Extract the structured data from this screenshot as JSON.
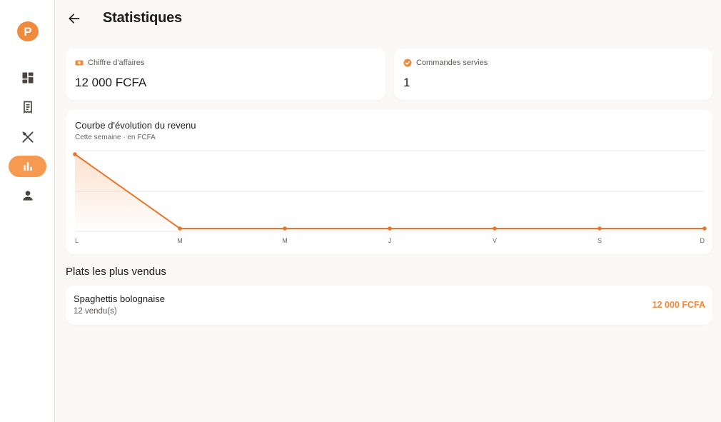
{
  "app": {
    "logo_letter": "P",
    "brand_color": "#f08a3c"
  },
  "sidebar": {
    "items": [
      {
        "icon": "dashboard-icon",
        "active": false
      },
      {
        "icon": "receipt-icon",
        "active": false
      },
      {
        "icon": "restaurant-icon",
        "active": false
      },
      {
        "icon": "bar-chart-icon",
        "active": true
      },
      {
        "icon": "person-icon",
        "active": false
      }
    ]
  },
  "header": {
    "back_icon": "arrow-left-icon",
    "title": "Statistiques"
  },
  "kpis": {
    "revenue": {
      "label": "Chiffre d'affaires",
      "value": "12 000 FCFA",
      "icon": "money-icon"
    },
    "orders": {
      "label": "Commandes servies",
      "value": "1",
      "icon": "check-circle-icon"
    }
  },
  "chart_data": {
    "type": "area",
    "title": "Courbe d'évolution du revenu",
    "subtitle": "Cette semaine · en FCFA",
    "categories": [
      "L",
      "M",
      "M",
      "J",
      "V",
      "S",
      "D"
    ],
    "values": [
      12000,
      0,
      0,
      0,
      0,
      0,
      0
    ],
    "ylim": [
      0,
      12000
    ],
    "grid": true,
    "line_color": "#e8762a"
  },
  "top_dishes": {
    "title": "Plats les plus vendus",
    "items": [
      {
        "name": "Spaghettis bolognaise",
        "count": "12 vendu(s)",
        "amount": "12 000 FCFA"
      }
    ]
  }
}
